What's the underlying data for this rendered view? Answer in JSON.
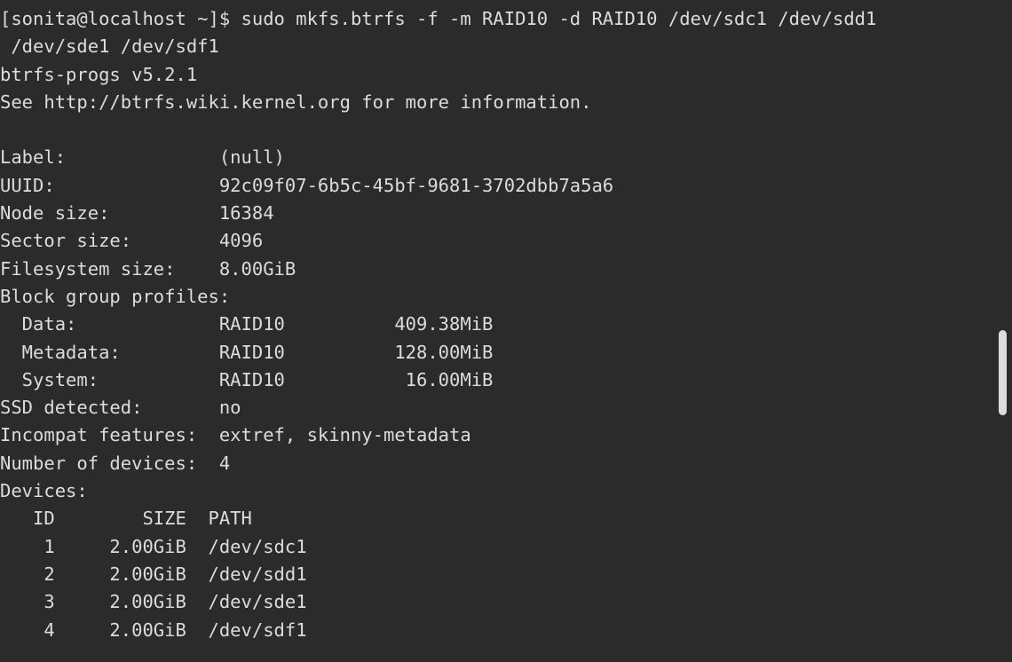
{
  "terminal": {
    "lines": [
      "[sonita@localhost ~]$ sudo mkfs.btrfs -f -m RAID10 -d RAID10 /dev/sdc1 /dev/sdd1",
      " /dev/sde1 /dev/sdf1",
      "btrfs-progs v5.2.1",
      "See http://btrfs.wiki.kernel.org for more information.",
      "",
      "Label:              (null)",
      "UUID:               92c09f07-6b5c-45bf-9681-3702dbb7a5a6",
      "Node size:          16384",
      "Sector size:        4096",
      "Filesystem size:    8.00GiB",
      "Block group profiles:",
      "  Data:             RAID10          409.38MiB",
      "  Metadata:         RAID10          128.00MiB",
      "  System:           RAID10           16.00MiB",
      "SSD detected:       no",
      "Incompat features:  extref, skinny-metadata",
      "Number of devices:  4",
      "Devices:",
      "   ID        SIZE  PATH",
      "    1     2.00GiB  /dev/sdc1",
      "    2     2.00GiB  /dev/sdd1",
      "    3     2.00GiB  /dev/sde1",
      "    4     2.00GiB  /dev/sdf1"
    ],
    "colors": {
      "background": "#2b2b2b",
      "foreground": "#dcdcdc",
      "scrollbar": "#dcdcdc"
    }
  }
}
